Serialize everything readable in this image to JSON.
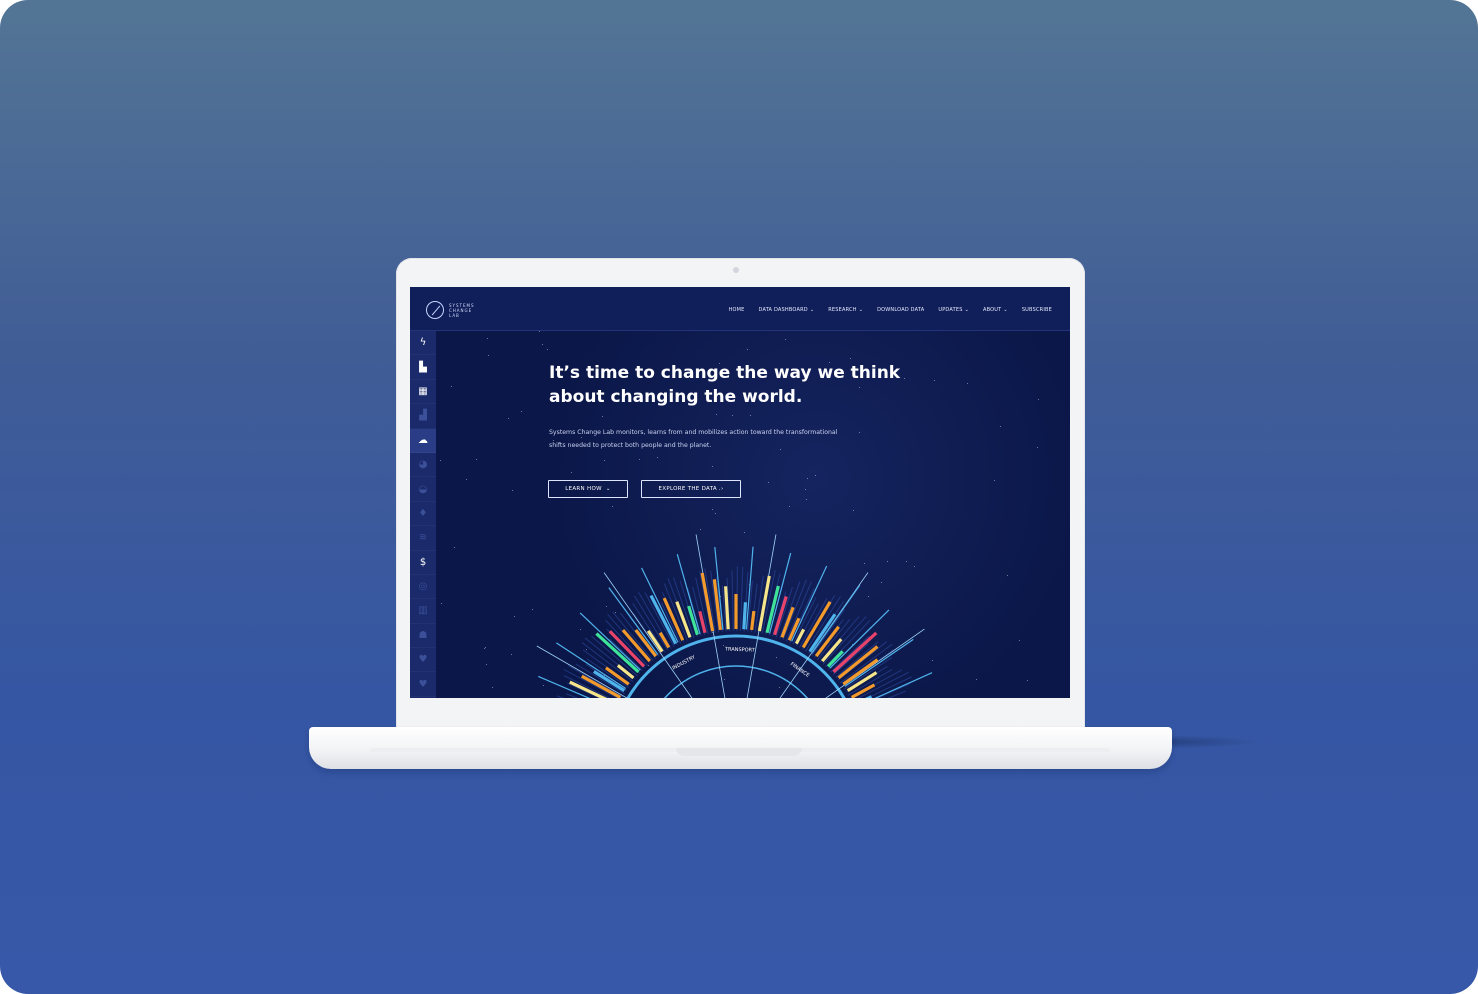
{
  "site": {
    "logo": {
      "line1": "SYSTEMS",
      "line2": "CHANGE",
      "line3": "LAB"
    },
    "nav": [
      {
        "label": "HOME",
        "has_dropdown": false
      },
      {
        "label": "DATA DASHBOARD",
        "has_dropdown": true
      },
      {
        "label": "RESEARCH",
        "has_dropdown": true
      },
      {
        "label": "DOWNLOAD DATA",
        "has_dropdown": false
      },
      {
        "label": "UPDATES",
        "has_dropdown": true
      },
      {
        "label": "ABOUT",
        "has_dropdown": true
      },
      {
        "label": "SUBSCRIBE",
        "has_dropdown": false
      }
    ],
    "sidebar_icons": [
      {
        "name": "power-icon",
        "glyph": "ϟ",
        "state": "normal"
      },
      {
        "name": "industry-icon",
        "glyph": "▙",
        "state": "normal"
      },
      {
        "name": "buildings-icon",
        "glyph": "▦",
        "state": "normal"
      },
      {
        "name": "city-icon",
        "glyph": "▟",
        "state": "dim"
      },
      {
        "name": "cloud-transport-icon",
        "glyph": "☁",
        "state": "active"
      },
      {
        "name": "food-icon",
        "glyph": "◕",
        "state": "dim"
      },
      {
        "name": "land-icon",
        "glyph": "◒",
        "state": "dim"
      },
      {
        "name": "water-icon",
        "glyph": "♦",
        "state": "dim"
      },
      {
        "name": "ocean-icon",
        "glyph": "≋",
        "state": "dim"
      },
      {
        "name": "finance-icon",
        "glyph": "$",
        "state": "normal"
      },
      {
        "name": "target-icon",
        "glyph": "◎",
        "state": "dim"
      },
      {
        "name": "government-icon",
        "glyph": "▥",
        "state": "dim"
      },
      {
        "name": "people-icon",
        "glyph": "☗",
        "state": "dim"
      },
      {
        "name": "handshake-icon",
        "glyph": "♥",
        "state": "dim"
      },
      {
        "name": "support-icon",
        "glyph": "♥",
        "state": "dim"
      }
    ],
    "hero": {
      "headline": "It’s time to change the way we think about changing the world.",
      "subtext": "Systems Change Lab monitors, learns from and mobilizes action toward the transformational shifts needed to protect both people and the planet.",
      "learn_button": "LEARN HOW",
      "explore_button": "EXPLORE THE DATA",
      "chevron_down": "⌄",
      "chevron_right": "›"
    },
    "chat_icon": "▤",
    "wheel_labels": [
      "INDUSTRY",
      "TRANSPORT",
      "FINANCE"
    ],
    "colors": {
      "background": "#0b1748",
      "nav": "#101f5a",
      "accent_blue": "#4fb3ec",
      "orange": "#f39a2d",
      "yellow": "#f6e58a",
      "green": "#3ee39a",
      "pink": "#e8436b"
    }
  }
}
